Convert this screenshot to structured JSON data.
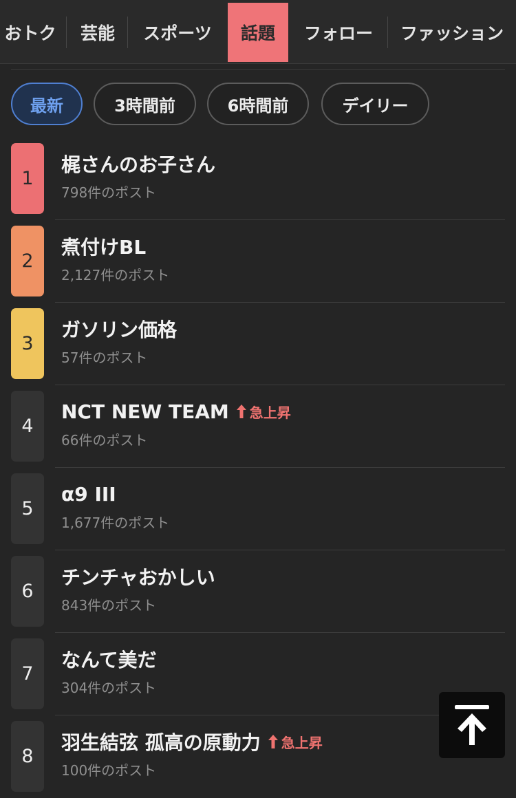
{
  "category_tabs": [
    {
      "label": "おトク"
    },
    {
      "label": "芸能"
    },
    {
      "label": "スポーツ"
    },
    {
      "label": "話題",
      "active": true
    },
    {
      "label": "フォロー"
    },
    {
      "label": "ファッション"
    }
  ],
  "time_filters": [
    {
      "label": "最新",
      "active": true
    },
    {
      "label": "3時間前"
    },
    {
      "label": "6時間前"
    },
    {
      "label": "デイリー"
    }
  ],
  "rankings": [
    {
      "rank": "1",
      "title": "梶さんのお子さん",
      "posts": "798件のポスト",
      "badge_color": "#ec7073"
    },
    {
      "rank": "2",
      "title": "煮付けBL",
      "posts": "2,127件のポスト",
      "badge_color": "#ef9264"
    },
    {
      "rank": "3",
      "title": "ガソリン価格",
      "posts": "57件のポスト",
      "badge_color": "#efc55d"
    },
    {
      "rank": "4",
      "title": "NCT NEW TEAM",
      "posts": "66件のポスト",
      "surge": "急上昇"
    },
    {
      "rank": "5",
      "title": "α9 III",
      "posts": "1,677件のポスト"
    },
    {
      "rank": "6",
      "title": "チンチャおかしい",
      "posts": "843件のポスト"
    },
    {
      "rank": "7",
      "title": "なんて美だ",
      "posts": "304件のポスト"
    },
    {
      "rank": "8",
      "title": "羽生結弦 孤高の原動力",
      "posts": "100件のポスト",
      "surge": "急上昇"
    }
  ],
  "colors": {
    "accent_tab": "#ef7478",
    "active_filter": "#6ea0ee",
    "surge": "#ef7370"
  },
  "icons": {
    "surge": "up-arrow-icon",
    "back_to_top": "arrow-up-to-top-icon"
  }
}
